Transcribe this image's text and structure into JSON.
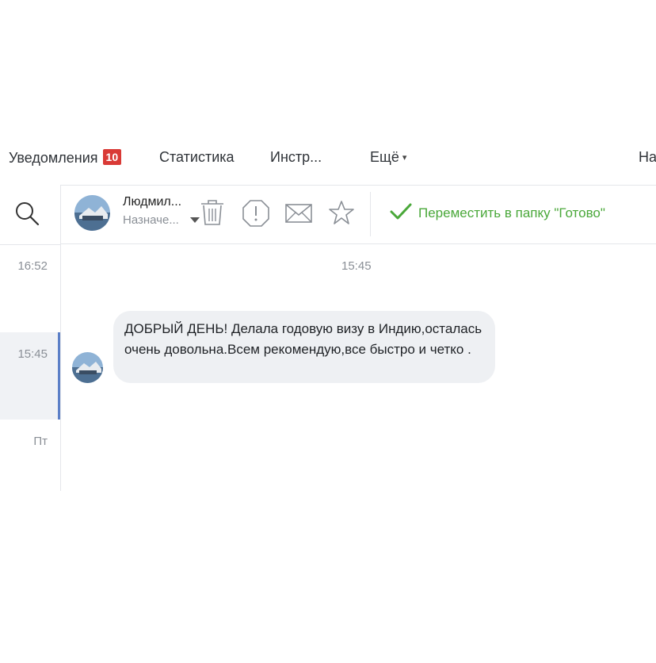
{
  "nav": {
    "notifications_label": "Уведомления",
    "notifications_count": "10",
    "statistics_label": "Статистика",
    "tools_label": "Инстр...",
    "more_label": "Ещё",
    "more_caret": "▾",
    "settings_label": "На"
  },
  "conversations": {
    "items": [
      {
        "time": "16:52"
      },
      {
        "time": "15:45"
      },
      {
        "time": "Пт"
      }
    ]
  },
  "header": {
    "contact_name": "Людмил...",
    "assign_label": "Назначе..."
  },
  "toolbar": {
    "move_label": "Переместить в папку \"Готово\"",
    "icons": [
      "trash-icon",
      "spam-icon",
      "mail-icon",
      "star-icon"
    ]
  },
  "chat": {
    "time_divider": "15:45",
    "message_text": "ДОБРЫЙ ДЕНЬ! Делала годовую визу в Индию,осталась очень довольна.Всем рекомендую,все быстро и четко ."
  },
  "colors": {
    "badge": "#d93a36",
    "accent_green": "#4aa83a",
    "active_marker": "#5b7fc7",
    "bubble_bg": "#eef0f3"
  }
}
